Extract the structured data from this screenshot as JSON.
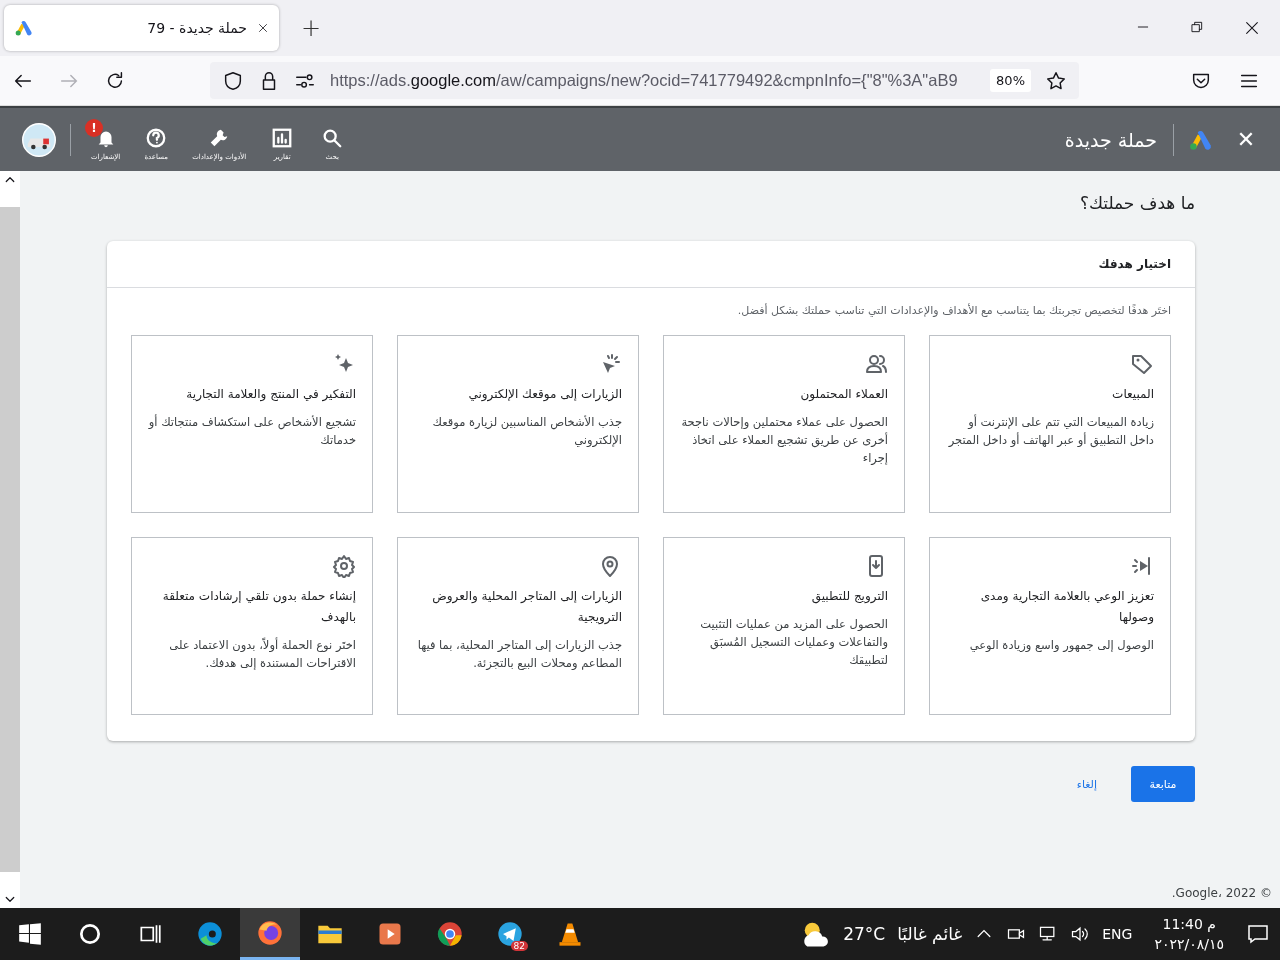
{
  "browser": {
    "tab": {
      "title": "حملة جديدة - 79",
      "selected": true
    },
    "new_tab": "+",
    "url": {
      "scheme": "https://ads.",
      "domain": "google.com",
      "path": "/aw/campaigns/new?ocid=741779492&cmpnInfo={\"8\"%3A\"aB9"
    },
    "zoom": "80%"
  },
  "app_header": {
    "close": "✕",
    "title": "حملة جديدة",
    "nav": [
      {
        "label": "بحث",
        "kind": "search"
      },
      {
        "label": "تقارير",
        "kind": "reports"
      },
      {
        "label": "الأدوات والإعدادات",
        "kind": "tools"
      },
      {
        "label": "مساعدة",
        "kind": "help"
      },
      {
        "label": "الإشعارات",
        "kind": "notifications",
        "badge": "!"
      }
    ]
  },
  "page": {
    "heading": "ما هدف حملتك؟",
    "card": {
      "title": "اختيار هدفك",
      "description": "اختَر هدفًا لتخصيص تجربتك بما يتناسب مع الأهداف والإعدادات التي تناسب حملتك بشكل أفضل.",
      "goals": [
        {
          "kind": "sales",
          "title": "المبيعات",
          "description": "زيادة المبيعات التي تتم على الإنترنت أو داخل التطبيق أو عبر الهاتف أو داخل المتجر"
        },
        {
          "kind": "leads",
          "title": "العملاء المحتملون",
          "description": "الحصول على عملاء محتملين وإحالات ناجحة أخرى عن طريق تشجيع العملاء على اتخاذ إجراء"
        },
        {
          "kind": "traffic",
          "title": "الزيارات إلى موقعك الإلكتروني",
          "description": "جذب الأشخاص المناسبين لزيارة موقعك الإلكتروني"
        },
        {
          "kind": "consideration",
          "title": "التفكير في المنتج والعلامة التجارية",
          "description": "تشجيع الأشخاص على استكشاف منتجاتك أو خدماتك"
        },
        {
          "kind": "awareness",
          "title": "تعزيز الوعي بالعلامة التجارية ومدى وصولها",
          "description": "الوصول إلى جمهور واسع وزيادة الوعي"
        },
        {
          "kind": "app",
          "title": "الترويج للتطبيق",
          "description": "الحصول على المزيد من عمليات التثبيت والتفاعلات وعمليات التسجيل المُسبَق لتطبيقك"
        },
        {
          "kind": "local",
          "title": "الزيارات إلى المتاجر المحلية والعروض الترويجية",
          "description": "جذب الزيارات إلى المتاجر المحلية، بما فيها المطاعم ومحلات البيع بالتجزئة."
        },
        {
          "kind": "none",
          "title": "إنشاء حملة بدون تلقي إرشادات متعلقة بالهدف",
          "description": "اختَر نوع الحملة أولاً، بدون الاعتماد على الاقتراحات المستندة إلى هدفك."
        }
      ]
    },
    "continue": "متابعة",
    "cancel": "إلغاء",
    "footer": "© 2022 ،Google."
  },
  "taskbar": {
    "apps": [
      {
        "kind": "edge",
        "selected": false
      },
      {
        "kind": "firefox",
        "selected": true
      },
      {
        "kind": "folder",
        "selected": false
      },
      {
        "kind": "player",
        "selected": false
      },
      {
        "kind": "chrome",
        "selected": false
      },
      {
        "kind": "telegram",
        "selected": false,
        "badge": "82"
      },
      {
        "kind": "vlc",
        "selected": false
      }
    ],
    "temperature": "27°C",
    "weather": "غائم غالبًا",
    "language": "ENG",
    "time": "11:40 م",
    "date": "٢٠٢٢/٠٨/١٥"
  }
}
